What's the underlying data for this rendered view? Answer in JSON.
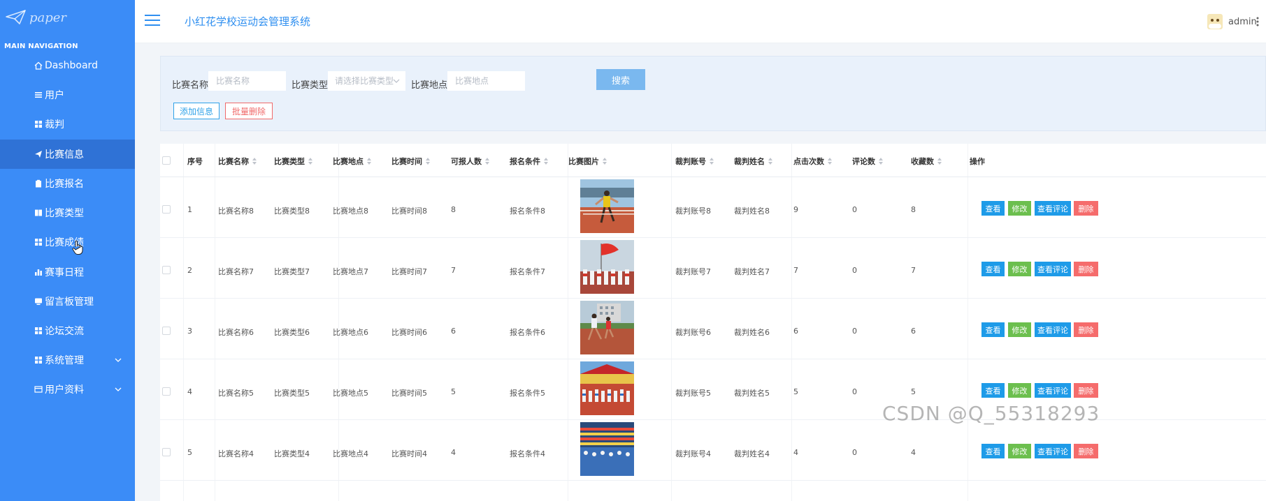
{
  "logo": {
    "text": "paper"
  },
  "sidebar": {
    "title": "MAIN NAVIGATION",
    "items": [
      {
        "label": "Dashboard",
        "icon": "home-icon"
      },
      {
        "label": "用户",
        "icon": "list-icon"
      },
      {
        "label": "裁判",
        "icon": "grid-icon"
      },
      {
        "label": "比赛信息",
        "icon": "send-icon",
        "active": true
      },
      {
        "label": "比赛报名",
        "icon": "clipboard-icon"
      },
      {
        "label": "比赛类型",
        "icon": "book-icon"
      },
      {
        "label": "比赛成绩",
        "icon": "grid-icon"
      },
      {
        "label": "赛事日程",
        "icon": "bar-chart-icon"
      },
      {
        "label": "留言板管理",
        "icon": "monitor-icon"
      },
      {
        "label": "论坛交流",
        "icon": "grid-icon"
      },
      {
        "label": "系统管理",
        "icon": "grid-icon",
        "expandable": true
      },
      {
        "label": "用户资料",
        "icon": "id-card-icon",
        "expandable": true
      }
    ]
  },
  "header": {
    "title": "小红花学校运动会管理系统",
    "user": "admin"
  },
  "search": {
    "name_label": "比赛名称",
    "name_placeholder": "比赛名称",
    "type_label": "比赛类型",
    "type_placeholder": "请选择比赛类型",
    "place_label": "比赛地点",
    "place_placeholder": "比赛地点",
    "search_button": "搜索",
    "add_button": "添加信息",
    "batch_delete_button": "批量删除"
  },
  "table": {
    "headers": [
      "序号",
      "比赛名称",
      "比赛类型",
      "比赛地点",
      "比赛时间",
      "可报人数",
      "报名条件",
      "比赛图片",
      "裁判账号",
      "裁判姓名",
      "点击次数",
      "评论数",
      "收藏数",
      "操作"
    ],
    "actions": {
      "view": "查看",
      "edit": "修改",
      "comments": "查看评论",
      "delete": "删除"
    },
    "rows": [
      {
        "index": "1",
        "name": "比赛名称8",
        "type": "比赛类型8",
        "place": "比赛地点8",
        "time": "比赛时间8",
        "quota": "8",
        "condition": "报名条件8",
        "judge_account": "裁判账号8",
        "judge_name": "裁判姓名8",
        "clicks": "9",
        "comments": "0",
        "favorites": "8"
      },
      {
        "index": "2",
        "name": "比赛名称7",
        "type": "比赛类型7",
        "place": "比赛地点7",
        "time": "比赛时间7",
        "quota": "7",
        "condition": "报名条件7",
        "judge_account": "裁判账号7",
        "judge_name": "裁判姓名7",
        "clicks": "7",
        "comments": "0",
        "favorites": "7"
      },
      {
        "index": "3",
        "name": "比赛名称6",
        "type": "比赛类型6",
        "place": "比赛地点6",
        "time": "比赛时间6",
        "quota": "6",
        "condition": "报名条件6",
        "judge_account": "裁判账号6",
        "judge_name": "裁判姓名6",
        "clicks": "6",
        "comments": "0",
        "favorites": "6"
      },
      {
        "index": "4",
        "name": "比赛名称5",
        "type": "比赛类型5",
        "place": "比赛地点5",
        "time": "比赛时间5",
        "quota": "5",
        "condition": "报名条件5",
        "judge_account": "裁判账号5",
        "judge_name": "裁判姓名5",
        "clicks": "5",
        "comments": "0",
        "favorites": "5"
      },
      {
        "index": "5",
        "name": "比赛名称4",
        "type": "比赛类型4",
        "place": "比赛地点4",
        "time": "比赛时间4",
        "quota": "4",
        "condition": "报名条件4",
        "judge_account": "裁判账号4",
        "judge_name": "裁判姓名4",
        "clicks": "4",
        "comments": "0",
        "favorites": "4"
      }
    ]
  },
  "watermark": "CSDN @Q_55318293"
}
